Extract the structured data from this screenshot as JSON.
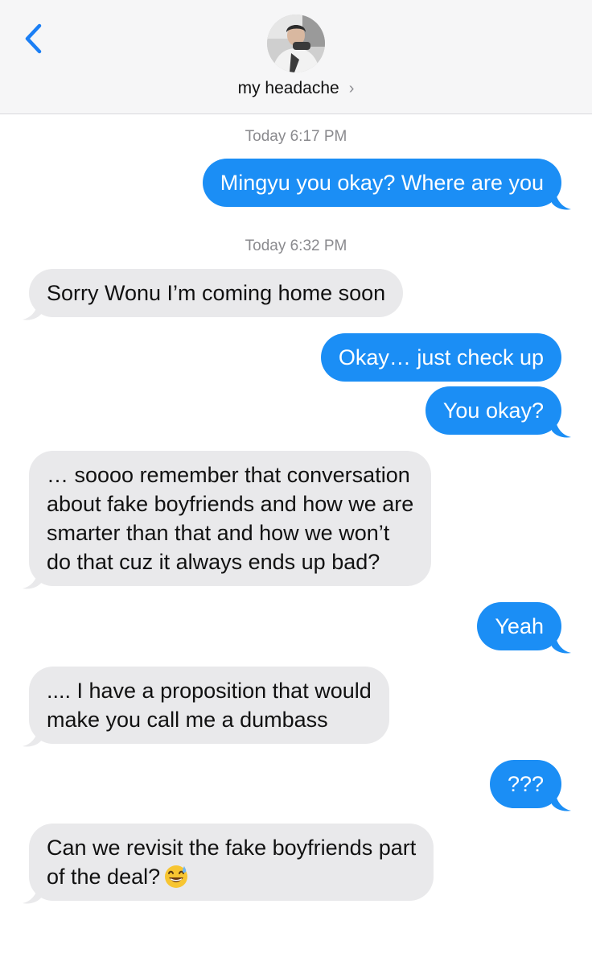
{
  "header": {
    "contact_name": "my headache",
    "chevron": "›",
    "back_icon": "chevron-left-icon"
  },
  "colors": {
    "sent_bubble": "#1b8ef5",
    "received_bubble": "#e9e9eb",
    "accent": "#1b7ff5"
  },
  "timestamps": [
    "Today 6:17 PM",
    "Today 6:32 PM"
  ],
  "messages": [
    {
      "from": "me",
      "lines": [
        "Mingyu you okay? Where are you"
      ]
    },
    {
      "from": "them",
      "lines": [
        "Sorry Wonu I’m coming home soon"
      ]
    },
    {
      "from": "me",
      "lines": [
        "Okay… just check up"
      ]
    },
    {
      "from": "me",
      "lines": [
        "You okay?"
      ]
    },
    {
      "from": "them",
      "lines": [
        "… soooo remember that conversation",
        "about fake boyfriends and how we are",
        "smarter than that and how we won’t",
        "do that cuz it always ends up bad?"
      ]
    },
    {
      "from": "me",
      "lines": [
        "Yeah"
      ]
    },
    {
      "from": "them",
      "lines": [
        ".... I have a proposition that would",
        "make you call me a dumbass"
      ]
    },
    {
      "from": "me",
      "lines": [
        "???"
      ]
    },
    {
      "from": "them",
      "lines": [
        "Can we revisit the fake boyfriends part",
        "of the deal?"
      ],
      "emoji": "grinning-sweat-emoji"
    }
  ]
}
